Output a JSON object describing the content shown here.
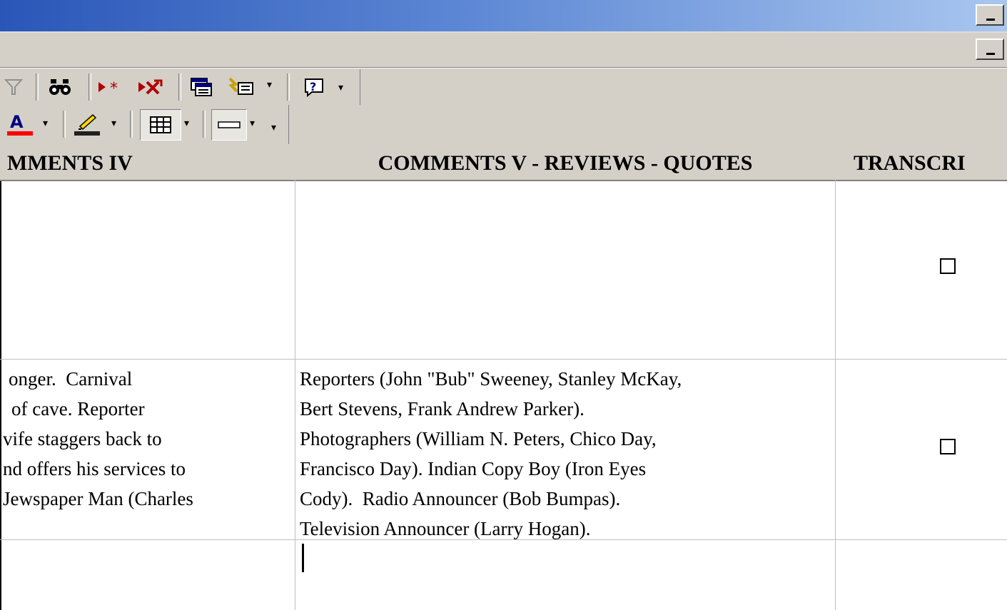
{
  "columns": [
    {
      "label": "MMENTS IV"
    },
    {
      "label": "COMMENTS V - REVIEWS - QUOTES"
    },
    {
      "label": "TRANSCRI"
    }
  ],
  "toolbar1": {
    "icons": [
      "filter-icon",
      "find-icon",
      "new-record-icon",
      "delete-record-icon",
      "database-window-icon",
      "new-object-icon",
      "help-icon"
    ]
  },
  "toolbar2": {
    "icons": [
      "font-color-icon",
      "line-color-icon",
      "gridlines-icon",
      "special-effect-icon"
    ]
  },
  "rows": [
    {
      "comments_iv": [],
      "comments_v": [],
      "transcript_checked": false
    },
    {
      "comments_iv": [
        "onger.  Carnival",
        "of cave. Reporter",
        "vife staggers back to",
        "nd offers his services to",
        "Jewspaper Man (Charles"
      ],
      "comments_v": [
        "Reporters (John \"Bub\" Sweeney, Stanley McKay,",
        "Bert Stevens, Frank Andrew Parker).",
        "Photographers (William N. Peters, Chico Day,",
        "Francisco Day). Indian Copy Boy (Iron Eyes",
        "Cody).  Radio Announcer (Bob Bumpas).",
        "Television Announcer (Larry Hogan)."
      ],
      "transcript_checked": false
    },
    {
      "comments_iv": [],
      "comments_v": [],
      "transcript_checked": null
    }
  ],
  "colors": {
    "title_start": "#2a56b8",
    "title_end": "#a9c6ef",
    "chrome": "#d4d0c8"
  }
}
